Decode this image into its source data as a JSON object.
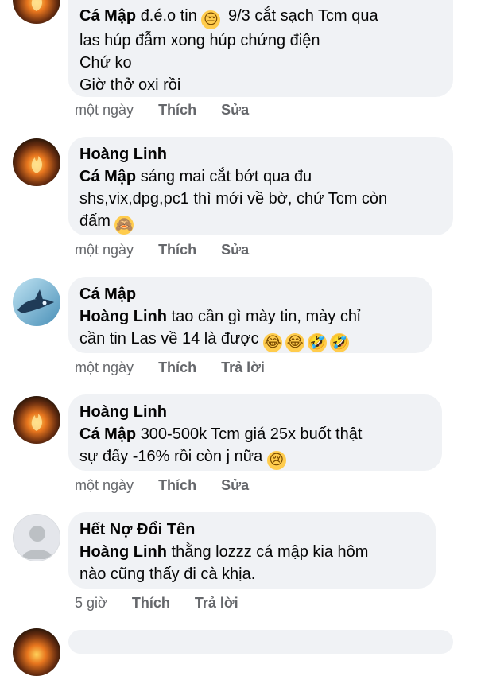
{
  "comments": [
    {
      "mention": "Cá Mập",
      "lines": [
        "đ.é.o tin",
        "9/3 cắt sạch Tcm qua",
        "las húp đẫm xong húp chứng điện",
        "Chứ ko",
        "Giờ thở oxi rồi"
      ],
      "emoji": "😒",
      "time": "một ngày",
      "like": "Thích",
      "action": "Sửa",
      "avatar_icon": "fire-avatar-icon"
    },
    {
      "name": "Hoàng Linh",
      "mention": "Cá Mập",
      "lines": [
        "sáng mai cắt bớt qua đu",
        "shs,vix,dpg,pc1 thì mới về bờ, chứ Tcm còn",
        "đấm"
      ],
      "emoji": "🙈",
      "time": "một ngày",
      "like": "Thích",
      "action": "Sửa",
      "avatar_icon": "fire-avatar-icon"
    },
    {
      "name": "Cá Mập",
      "mention": "Hoàng Linh",
      "lines": [
        "tao cần  gì mày tin, mày chỉ",
        "cần tin Las về 14 là được"
      ],
      "emojis": [
        "😂",
        "😂",
        "🤣",
        "🤣"
      ],
      "time": "một ngày",
      "like": "Thích",
      "action": "Trả lời",
      "avatar_icon": "shark-avatar-icon"
    },
    {
      "name": "Hoàng Linh",
      "mention": "Cá Mập",
      "lines": [
        "300-500k Tcm giá 25x buốt thật",
        "sự đấy -16% rồi còn j nữa"
      ],
      "emoji": "😢",
      "time": "một ngày",
      "like": "Thích",
      "action": "Sửa",
      "avatar_icon": "fire-avatar-icon"
    },
    {
      "name": "Hết Nợ Đổi Tên",
      "mention": "Hoàng Linh",
      "lines": [
        "thằng lozzz cá mập kia hôm",
        "nào cũng thấy đi cà khịa."
      ],
      "time": "5 giờ",
      "like": "Thích",
      "action": "Trả lời",
      "avatar_icon": "default-user-avatar-icon"
    }
  ]
}
